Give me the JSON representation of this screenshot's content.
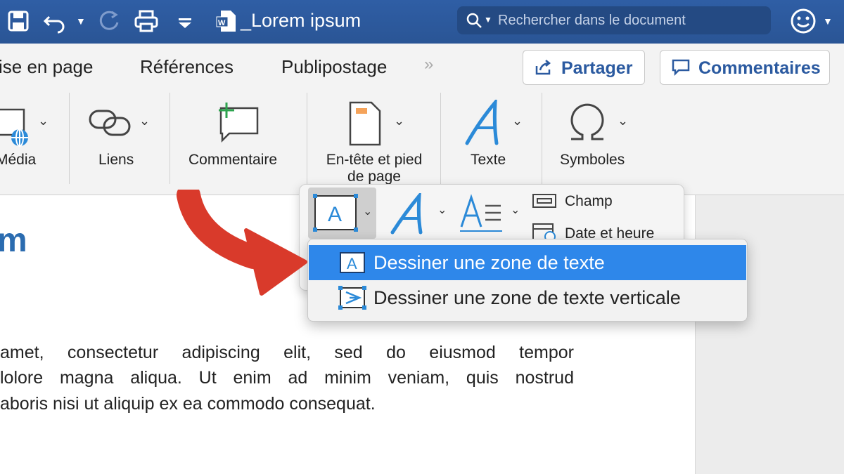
{
  "titlebar": {
    "doc_title": "_Lorem ipsum",
    "search_placeholder": "Rechercher dans le document"
  },
  "tabs": [
    {
      "label": "ise en page"
    },
    {
      "label": "Références"
    },
    {
      "label": "Publipostage"
    }
  ],
  "tab_more": "»",
  "buttons": {
    "share": "Partager",
    "comments": "Commentaires"
  },
  "ribbon": {
    "media": "Média",
    "links": "Liens",
    "comment": "Commentaire",
    "header_footer": "En-tête et pied de page",
    "text": "Texte",
    "symbols": "Symboles"
  },
  "text_popup": {
    "field": "Champ",
    "date_time": "Date et heure"
  },
  "menu": {
    "items": [
      {
        "label": "Dessiner une zone de texte",
        "selected": true
      },
      {
        "label": "Dessiner une zone de texte verticale",
        "selected": false
      }
    ]
  },
  "document": {
    "heading_fragment": "m",
    "lines": [
      "amet, consectetur adipiscing elit, sed do eiusmod tempor",
      "lolore magna aliqua. Ut enim ad minim veniam, quis nostrud",
      "aboris nisi ut aliquip ex ea commodo consequat."
    ]
  },
  "colors": {
    "titlebar": "#2b5797",
    "accent": "#2b5aa0",
    "menu_selected": "#2e87ea",
    "arrow": "#d93a2b",
    "heading": "#2b6cb0"
  }
}
